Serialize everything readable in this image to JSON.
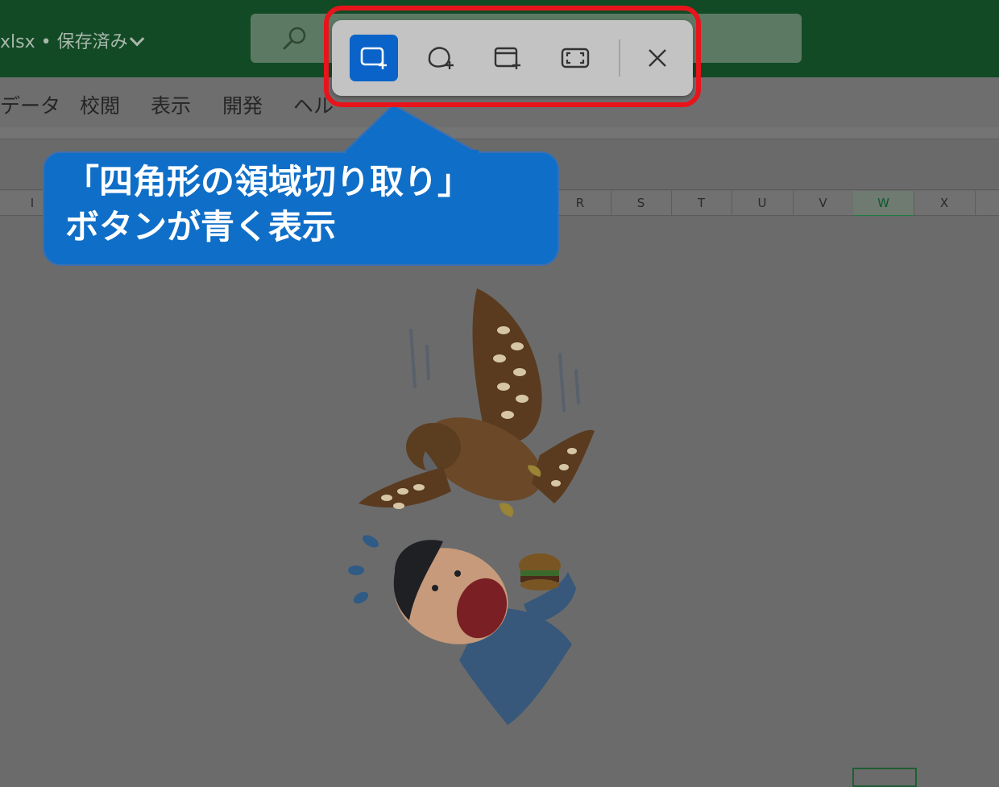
{
  "window": {
    "doc_title": "xlsx • 保存済み",
    "search_icon": "search-icon"
  },
  "ribbon": {
    "tabs": [
      "データ",
      "校閲",
      "表示",
      "開発",
      "ヘル"
    ]
  },
  "columns": [
    "I",
    "R",
    "S",
    "T",
    "U",
    "V",
    "W",
    "X"
  ],
  "selected_column": "W",
  "snipping_toolbar": {
    "buttons": [
      {
        "icon": "rectangle-snip-icon",
        "active": true
      },
      {
        "icon": "freeform-snip-icon",
        "active": false
      },
      {
        "icon": "window-snip-icon",
        "active": false
      },
      {
        "icon": "fullscreen-snip-icon",
        "active": false
      }
    ],
    "close_icon": "close-icon",
    "active_color": "#0a63c9",
    "highlight_color": "#e8141b"
  },
  "callout": {
    "line1": "「四角形の領域切り取り」",
    "line2": "ボタンが青く表示",
    "color": "#0f6ec7"
  }
}
